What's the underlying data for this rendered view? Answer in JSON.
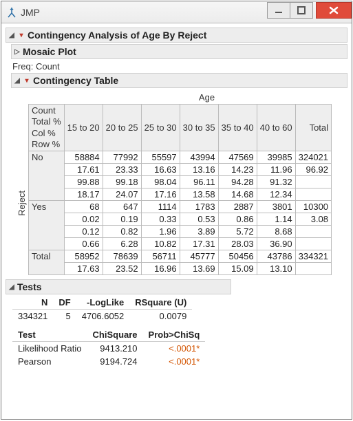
{
  "app": {
    "title": "JMP"
  },
  "main": {
    "title": "Contingency Analysis of Age By Reject",
    "mosaic": "Mosaic Plot",
    "freq_label": "Freq: Count",
    "ct_title": "Contingency Table",
    "col_axis": "Age",
    "row_axis": "Reject",
    "corner": [
      "Count",
      "Total %",
      "Col %",
      "Row %"
    ],
    "col_headers": [
      "15 to 20",
      "20 to 25",
      "25 to 30",
      "30 to 35",
      "35 to 40",
      "40 to 60",
      "Total"
    ],
    "rows": [
      {
        "label": "No",
        "lines": [
          [
            "58884",
            "77992",
            "55597",
            "43994",
            "47569",
            "39985",
            "324021"
          ],
          [
            "17.61",
            "23.33",
            "16.63",
            "13.16",
            "14.23",
            "11.96",
            "96.92"
          ],
          [
            "99.88",
            "99.18",
            "98.04",
            "96.11",
            "94.28",
            "91.32",
            ""
          ],
          [
            "18.17",
            "24.07",
            "17.16",
            "13.58",
            "14.68",
            "12.34",
            ""
          ]
        ]
      },
      {
        "label": "Yes",
        "lines": [
          [
            "68",
            "647",
            "1114",
            "1783",
            "2887",
            "3801",
            "10300"
          ],
          [
            "0.02",
            "0.19",
            "0.33",
            "0.53",
            "0.86",
            "1.14",
            "3.08"
          ],
          [
            "0.12",
            "0.82",
            "1.96",
            "3.89",
            "5.72",
            "8.68",
            ""
          ],
          [
            "0.66",
            "6.28",
            "10.82",
            "17.31",
            "28.03",
            "36.90",
            ""
          ]
        ]
      },
      {
        "label": "Total",
        "lines": [
          [
            "58952",
            "78639",
            "56711",
            "45777",
            "50456",
            "43786",
            "334321"
          ],
          [
            "17.63",
            "23.52",
            "16.96",
            "13.69",
            "15.09",
            "13.10",
            ""
          ]
        ]
      }
    ]
  },
  "tests": {
    "title": "Tests",
    "h1": [
      "N",
      "DF",
      "-LogLike",
      "RSquare (U)"
    ],
    "r1": [
      "334321",
      "5",
      "4706.6052",
      "0.0079"
    ],
    "h2": [
      "Test",
      "ChiSquare",
      "Prob>ChiSq"
    ],
    "rows2": [
      {
        "name": "Likelihood Ratio",
        "chi": "9413.210",
        "p": "<.0001*"
      },
      {
        "name": "Pearson",
        "chi": "9194.724",
        "p": "<.0001*"
      }
    ]
  }
}
